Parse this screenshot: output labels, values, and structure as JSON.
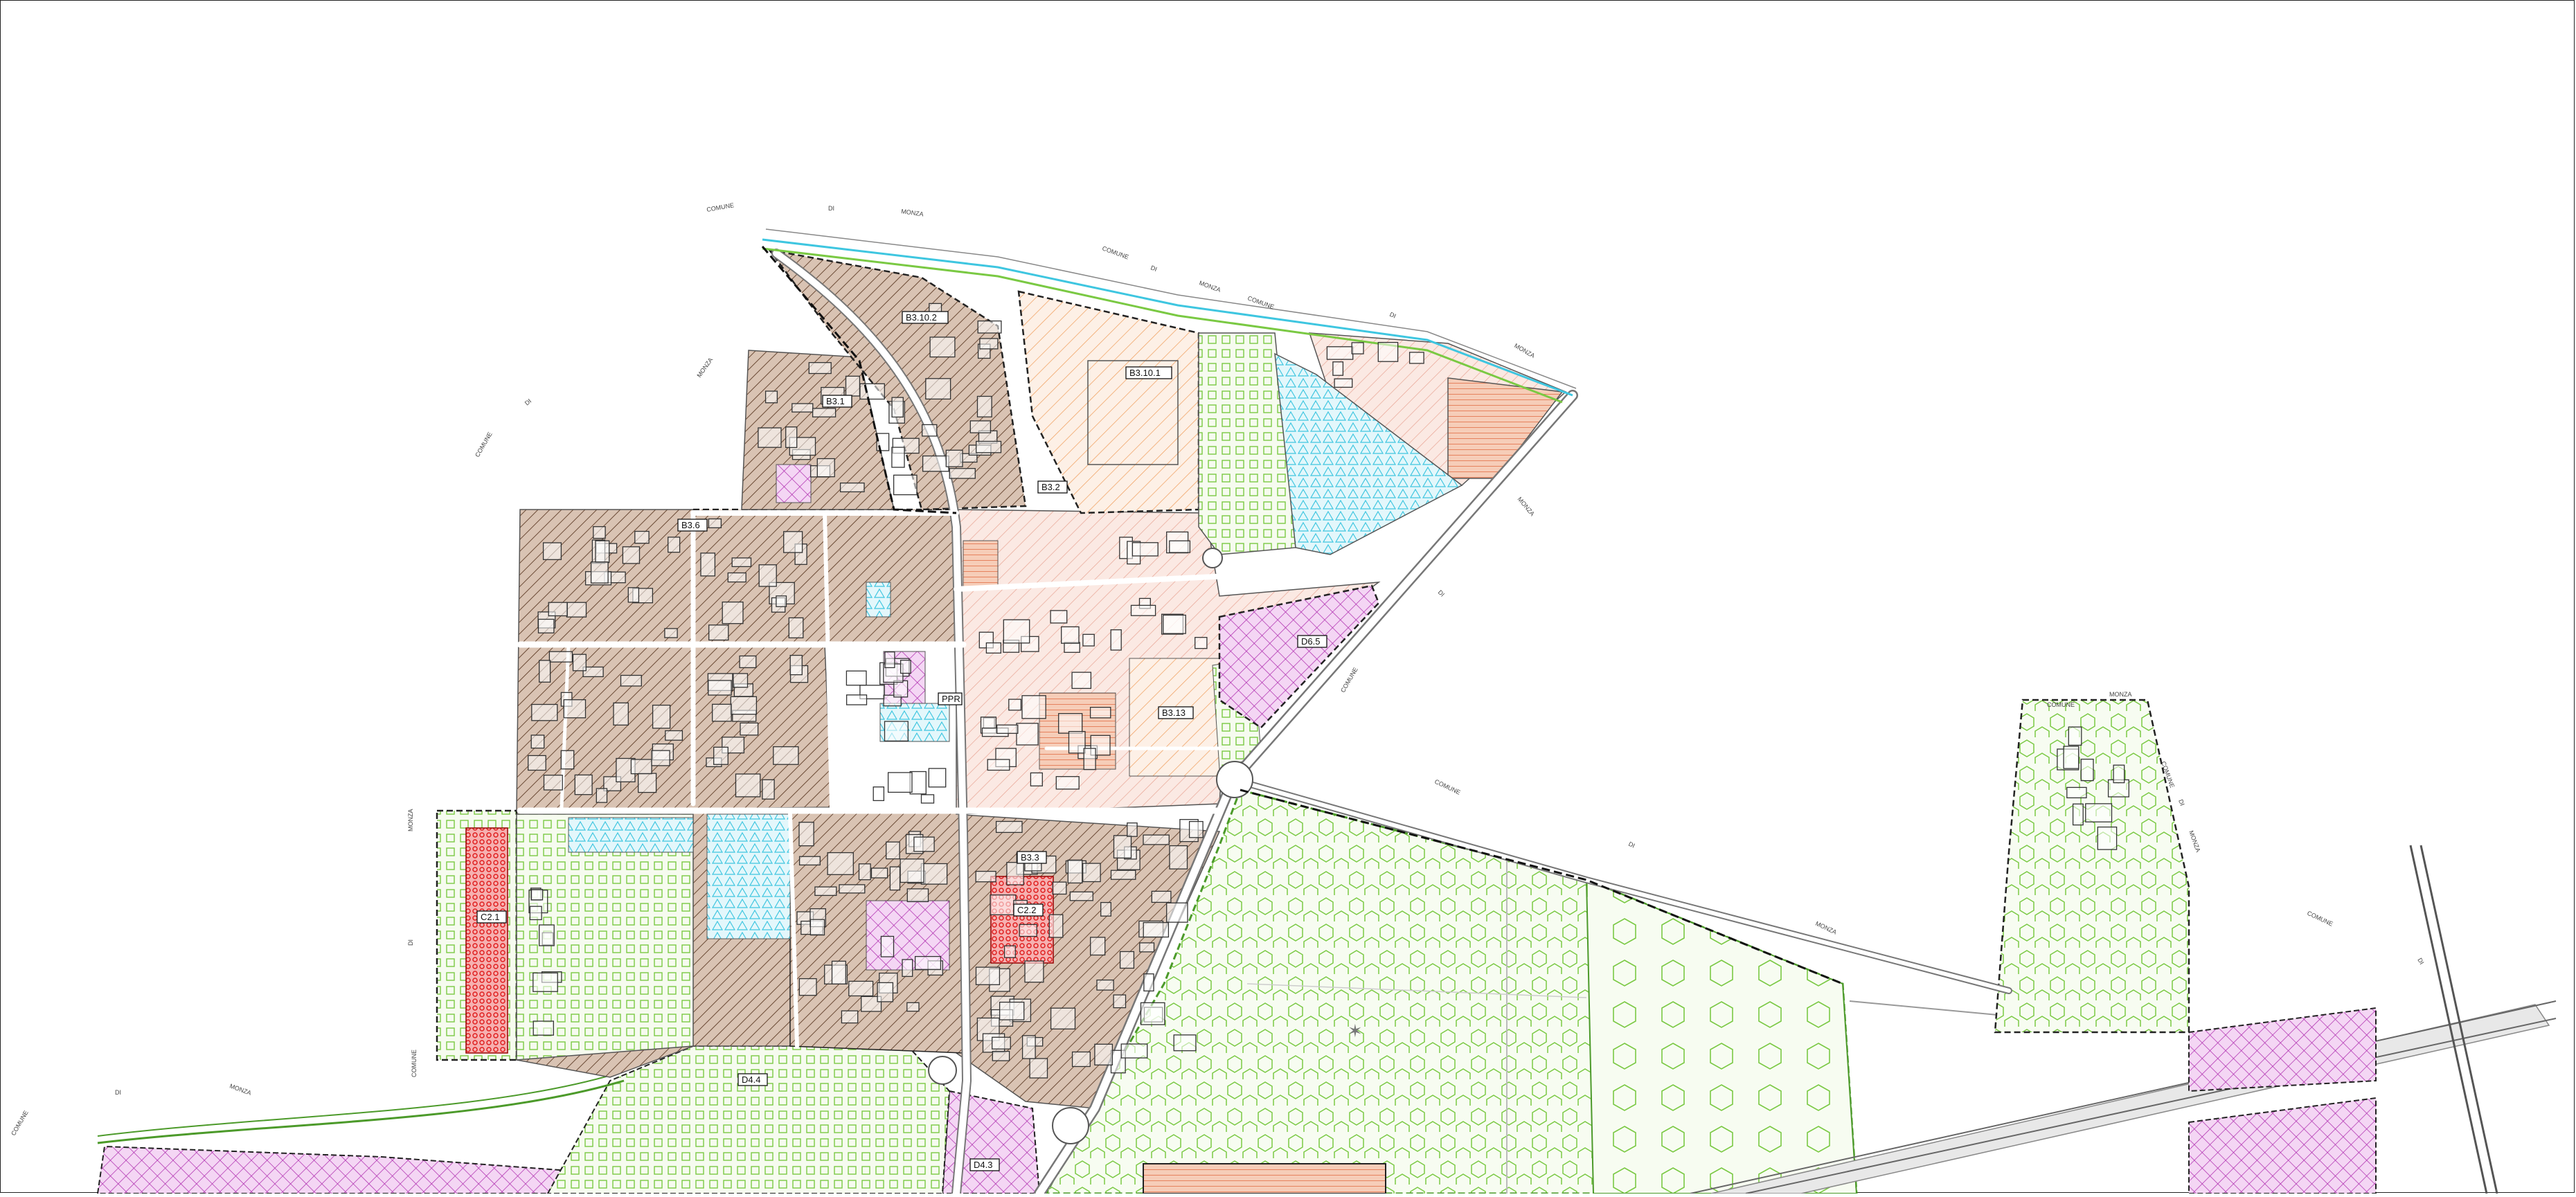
{
  "map": {
    "zone_labels": [
      "B3.10.2",
      "B3.10.1",
      "B3.1",
      "B3.2",
      "B3.6",
      "B3.3",
      "B3.13",
      "PPR",
      "C2.1",
      "C2.2",
      "D6.5",
      "D4.3",
      "D4.4"
    ],
    "municipality_labels": [
      "COMUNE",
      "DI",
      "MONZA"
    ],
    "road_labels": [
      "MONZA",
      "COMUNE",
      "DI"
    ],
    "colors": {
      "residential_brown": "#8b5a3c",
      "historic_pink": "#f2b8a8",
      "orange_hatch": "#f0a060",
      "green_space": "#7ac943",
      "services_cyan": "#3ec6e0",
      "productive_magenta": "#c040c0",
      "red_zone": "#e02020"
    },
    "icons": [
      "north-star-icon"
    ]
  }
}
